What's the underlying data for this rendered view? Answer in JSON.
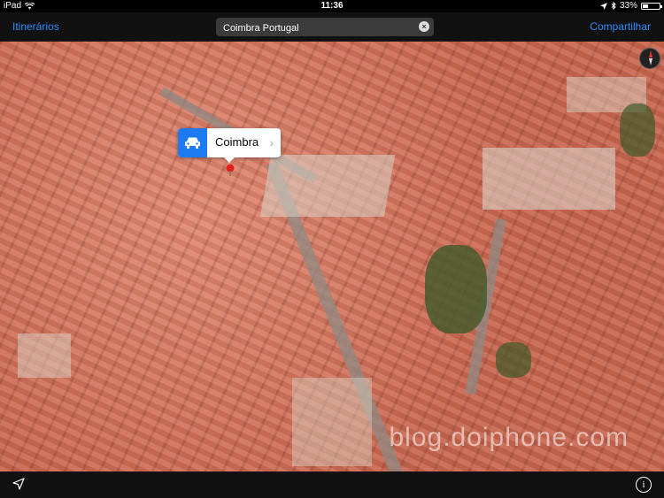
{
  "status": {
    "device": "iPad",
    "time": "11:36",
    "battery": "33%",
    "battery_level": 0.33
  },
  "nav": {
    "directions_label": "Itinerários",
    "share_label": "Compartilhar"
  },
  "search": {
    "value": "Coimbra Portugal"
  },
  "callout": {
    "title": "Coimbra"
  },
  "watermark": "blog.doiphone.com",
  "icons": {
    "wifi": "wifi-icon",
    "location": "location-arrow-icon",
    "bluetooth": "bluetooth-icon",
    "compass": "compass-icon",
    "car": "car-icon",
    "pin": "map-pin-icon",
    "info": "info-icon"
  }
}
